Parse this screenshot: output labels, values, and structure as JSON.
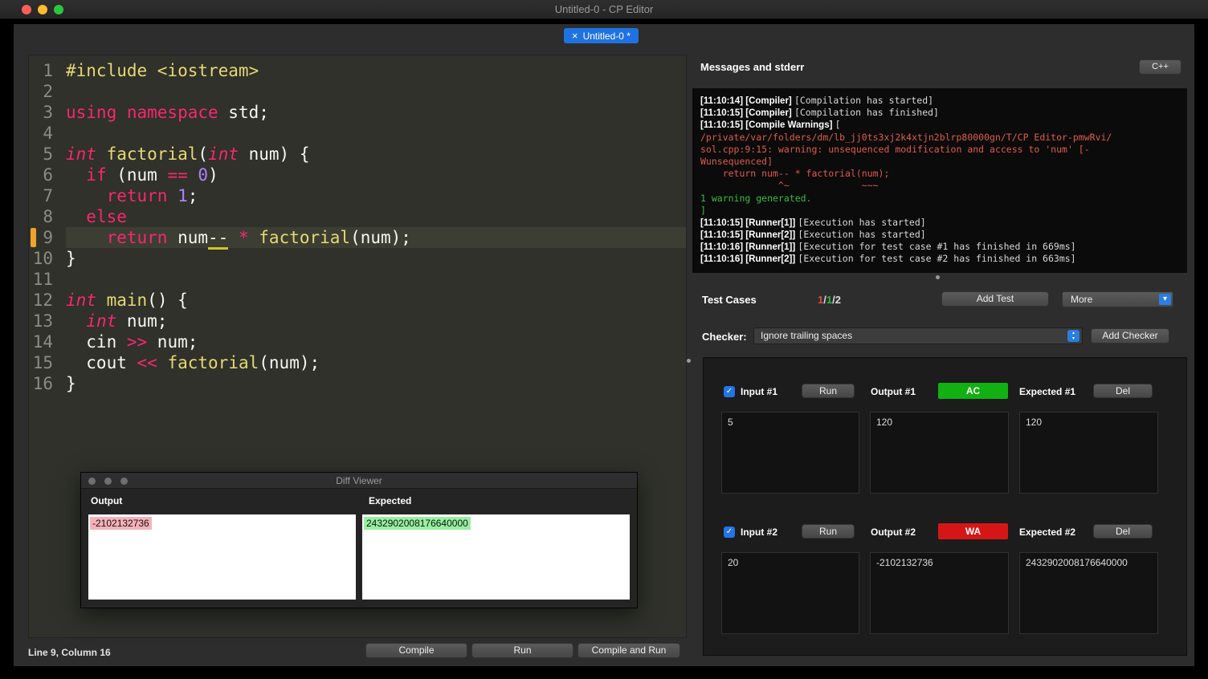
{
  "titlebar": {
    "title": "Untitled-0 - CP Editor"
  },
  "tab": {
    "close": "×",
    "label": "Untitled-0 *"
  },
  "icons": {
    "check": "✓",
    "dropdown_down": "▾",
    "spinner": "▴▾"
  },
  "editor": {
    "current_line": 9,
    "lines": [
      {
        "num": "1",
        "segs": [
          {
            "t": "#include <iostream>",
            "c": "yellow"
          }
        ]
      },
      {
        "num": "2",
        "segs": []
      },
      {
        "num": "3",
        "segs": [
          {
            "t": "using namespace",
            "c": "pink"
          },
          {
            "t": " std;",
            "c": "fg"
          }
        ]
      },
      {
        "num": "4",
        "segs": []
      },
      {
        "num": "5",
        "segs": [
          {
            "t": "int",
            "c": "type"
          },
          {
            "t": " ",
            "c": "fg"
          },
          {
            "t": "factorial",
            "c": "yellow"
          },
          {
            "t": "(",
            "c": "fg"
          },
          {
            "t": "int",
            "c": "type"
          },
          {
            "t": " num) {",
            "c": "fg"
          }
        ]
      },
      {
        "num": "6",
        "segs": [
          {
            "t": "  ",
            "c": "fg"
          },
          {
            "t": "if",
            "c": "pink"
          },
          {
            "t": " (num ",
            "c": "fg"
          },
          {
            "t": "==",
            "c": "pink"
          },
          {
            "t": " ",
            "c": "fg"
          },
          {
            "t": "0",
            "c": "purple"
          },
          {
            "t": ")",
            "c": "fg"
          }
        ]
      },
      {
        "num": "7",
        "segs": [
          {
            "t": "    ",
            "c": "fg"
          },
          {
            "t": "return",
            "c": "pink"
          },
          {
            "t": " ",
            "c": "fg"
          },
          {
            "t": "1",
            "c": "purple"
          },
          {
            "t": ";",
            "c": "fg"
          }
        ]
      },
      {
        "num": "8",
        "segs": [
          {
            "t": "  ",
            "c": "fg"
          },
          {
            "t": "else",
            "c": "pink"
          }
        ]
      },
      {
        "num": "9",
        "segs": [
          {
            "t": "    ",
            "c": "fg"
          },
          {
            "t": "return",
            "c": "pink"
          },
          {
            "t": " num",
            "c": "fg"
          },
          {
            "t": "--",
            "c": "und"
          },
          {
            "t": " ",
            "c": "fg"
          },
          {
            "t": "*",
            "c": "pink"
          },
          {
            "t": " ",
            "c": "fg"
          },
          {
            "t": "factorial",
            "c": "yellow"
          },
          {
            "t": "(num);",
            "c": "fg"
          }
        ]
      },
      {
        "num": "10",
        "segs": [
          {
            "t": "}",
            "c": "fg"
          }
        ]
      },
      {
        "num": "11",
        "segs": []
      },
      {
        "num": "12",
        "segs": [
          {
            "t": "int",
            "c": "type"
          },
          {
            "t": " ",
            "c": "fg"
          },
          {
            "t": "main",
            "c": "yellow"
          },
          {
            "t": "() {",
            "c": "fg"
          }
        ]
      },
      {
        "num": "13",
        "segs": [
          {
            "t": "  ",
            "c": "fg"
          },
          {
            "t": "int",
            "c": "type"
          },
          {
            "t": " num;",
            "c": "fg"
          }
        ]
      },
      {
        "num": "14",
        "segs": [
          {
            "t": "  cin ",
            "c": "fg"
          },
          {
            "t": ">>",
            "c": "pink"
          },
          {
            "t": " num;",
            "c": "fg"
          }
        ]
      },
      {
        "num": "15",
        "segs": [
          {
            "t": "  cout ",
            "c": "fg"
          },
          {
            "t": "<<",
            "c": "pink"
          },
          {
            "t": " ",
            "c": "fg"
          },
          {
            "t": "factorial",
            "c": "yellow"
          },
          {
            "t": "(num);",
            "c": "fg"
          }
        ]
      },
      {
        "num": "16",
        "segs": [
          {
            "t": "}",
            "c": "fg"
          }
        ]
      }
    ]
  },
  "messages": {
    "title": "Messages and stderr",
    "language": "C++",
    "log": [
      [
        {
          "t": "[11:10:14] [Compiler] ",
          "c": "meta"
        },
        {
          "t": "[Compilation has started]",
          "c": "mono"
        }
      ],
      [
        {
          "t": "[11:10:15] [Compiler] ",
          "c": "meta"
        },
        {
          "t": "[Compilation has finished]",
          "c": "mono"
        }
      ],
      [
        {
          "t": "[11:10:15] [Compile Warnings] ",
          "c": "meta"
        },
        {
          "t": "[",
          "c": "mono"
        }
      ],
      [
        {
          "t": "/private/var/folders/dm/lb_jj0ts3xj2k4xtjn2blrp80000gn/T/CP Editor-pmwRvi/",
          "c": "red"
        }
      ],
      [
        {
          "t": "sol.cpp:9:15: warning: unsequenced modification and access to 'num' [-",
          "c": "red"
        }
      ],
      [
        {
          "t": "Wunsequenced]",
          "c": "red"
        }
      ],
      [
        {
          "t": "    return num-- * factorial(num);",
          "c": "red"
        }
      ],
      [
        {
          "t": "              ^~             ~~~",
          "c": "red"
        }
      ],
      [
        {
          "t": "1 warning generated.",
          "c": "green"
        }
      ],
      [
        {
          "t": "]",
          "c": "green"
        }
      ],
      [
        {
          "t": "[11:10:15] [Runner[1]] ",
          "c": "meta"
        },
        {
          "t": "[Execution has started]",
          "c": "mono"
        }
      ],
      [
        {
          "t": "[11:10:15] [Runner[2]] ",
          "c": "meta"
        },
        {
          "t": "[Execution has started]",
          "c": "mono"
        }
      ],
      [
        {
          "t": "[11:10:16] [Runner[1]] ",
          "c": "meta"
        },
        {
          "t": "[Execution for test case #1 has finished in 669ms]",
          "c": "mono"
        }
      ],
      [
        {
          "t": "[11:10:16] [Runner[2]] ",
          "c": "meta"
        },
        {
          "t": "[Execution for test case #2 has finished in 663ms]",
          "c": "mono"
        }
      ]
    ]
  },
  "testcases_bar": {
    "label": "Test Cases",
    "summary": {
      "first": "1",
      "sep": "/",
      "second": "1",
      "total": "2"
    },
    "add_test": "Add Test",
    "more": "More"
  },
  "checker": {
    "label": "Checker:",
    "value": "Ignore trailing spaces",
    "add_checker": "Add Checker"
  },
  "testcases": [
    {
      "input_label": "Input #1",
      "run": "Run",
      "output_label": "Output #1",
      "verdict": "AC",
      "expected_label": "Expected #1",
      "del": "Del",
      "input": "5",
      "output": "120",
      "expected": "120"
    },
    {
      "input_label": "Input #2",
      "run": "Run",
      "output_label": "Output #2",
      "verdict": "WA",
      "expected_label": "Expected #2",
      "del": "Del",
      "input": "20",
      "output": "-2102132736",
      "expected": "2432902008176640000"
    }
  ],
  "diff": {
    "title": "Diff Viewer",
    "left_header": "Output",
    "right_header": "Expected",
    "left_value": "-2102132736",
    "right_value": "2432902008176640000"
  },
  "statusbar": {
    "position": "Line 9, Column 16",
    "compile": "Compile",
    "run": "Run",
    "compile_and_run": "Compile and Run"
  },
  "colors": {
    "accent_blue": "#2a7de1",
    "ac_green": "#12b012",
    "wa_red": "#d61616",
    "diff_del": "#f6b2b8",
    "diff_add": "#97f0a1"
  }
}
